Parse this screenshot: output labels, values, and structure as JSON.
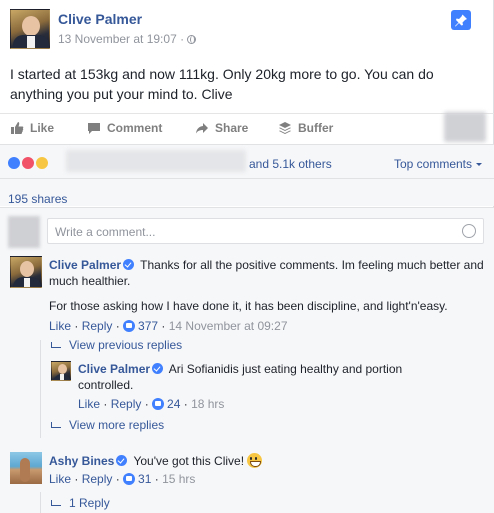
{
  "post": {
    "author": "Clive Palmer",
    "timestamp": "13 November at 19:07 ·",
    "text": "I started at 153kg and now 111kg. Only 20kg more to go. You can do anything you put your mind to. Clive"
  },
  "actions": {
    "like": "Like",
    "comment": "Comment",
    "share": "Share",
    "buffer": "Buffer"
  },
  "reactions": {
    "others_text": "and 5.1k others",
    "top_comments": "Top comments",
    "shares": "195 shares"
  },
  "comment_input": {
    "placeholder": "Write a comment..."
  },
  "comments": [
    {
      "author": "Clive Palmer",
      "text_1": "Thanks for all the positive comments. Im feeling much better and much healthier.",
      "text_2": "For those asking how I have done it, it has been discipline, and light'n'easy.",
      "like": "Like",
      "reply": "Reply",
      "likes": "377",
      "time": "14 November at 09:27",
      "view_previous": "View previous replies",
      "reply_item": {
        "author": "Clive Palmer",
        "text": "Ari Sofianidis just eating healthy and portion controlled.",
        "like": "Like",
        "reply": "Reply",
        "likes": "24",
        "time": "18 hrs"
      },
      "view_more": "View more replies"
    },
    {
      "author": "Ashy Bines",
      "text": "You've got this Clive!",
      "like": "Like",
      "reply": "Reply",
      "likes": "31",
      "time": "15 hrs",
      "replies_link": "1 Reply"
    }
  ],
  "colors": {
    "link_blue": "#365899",
    "accent_blue": "#4080ff",
    "muted_grey": "#90949c"
  }
}
